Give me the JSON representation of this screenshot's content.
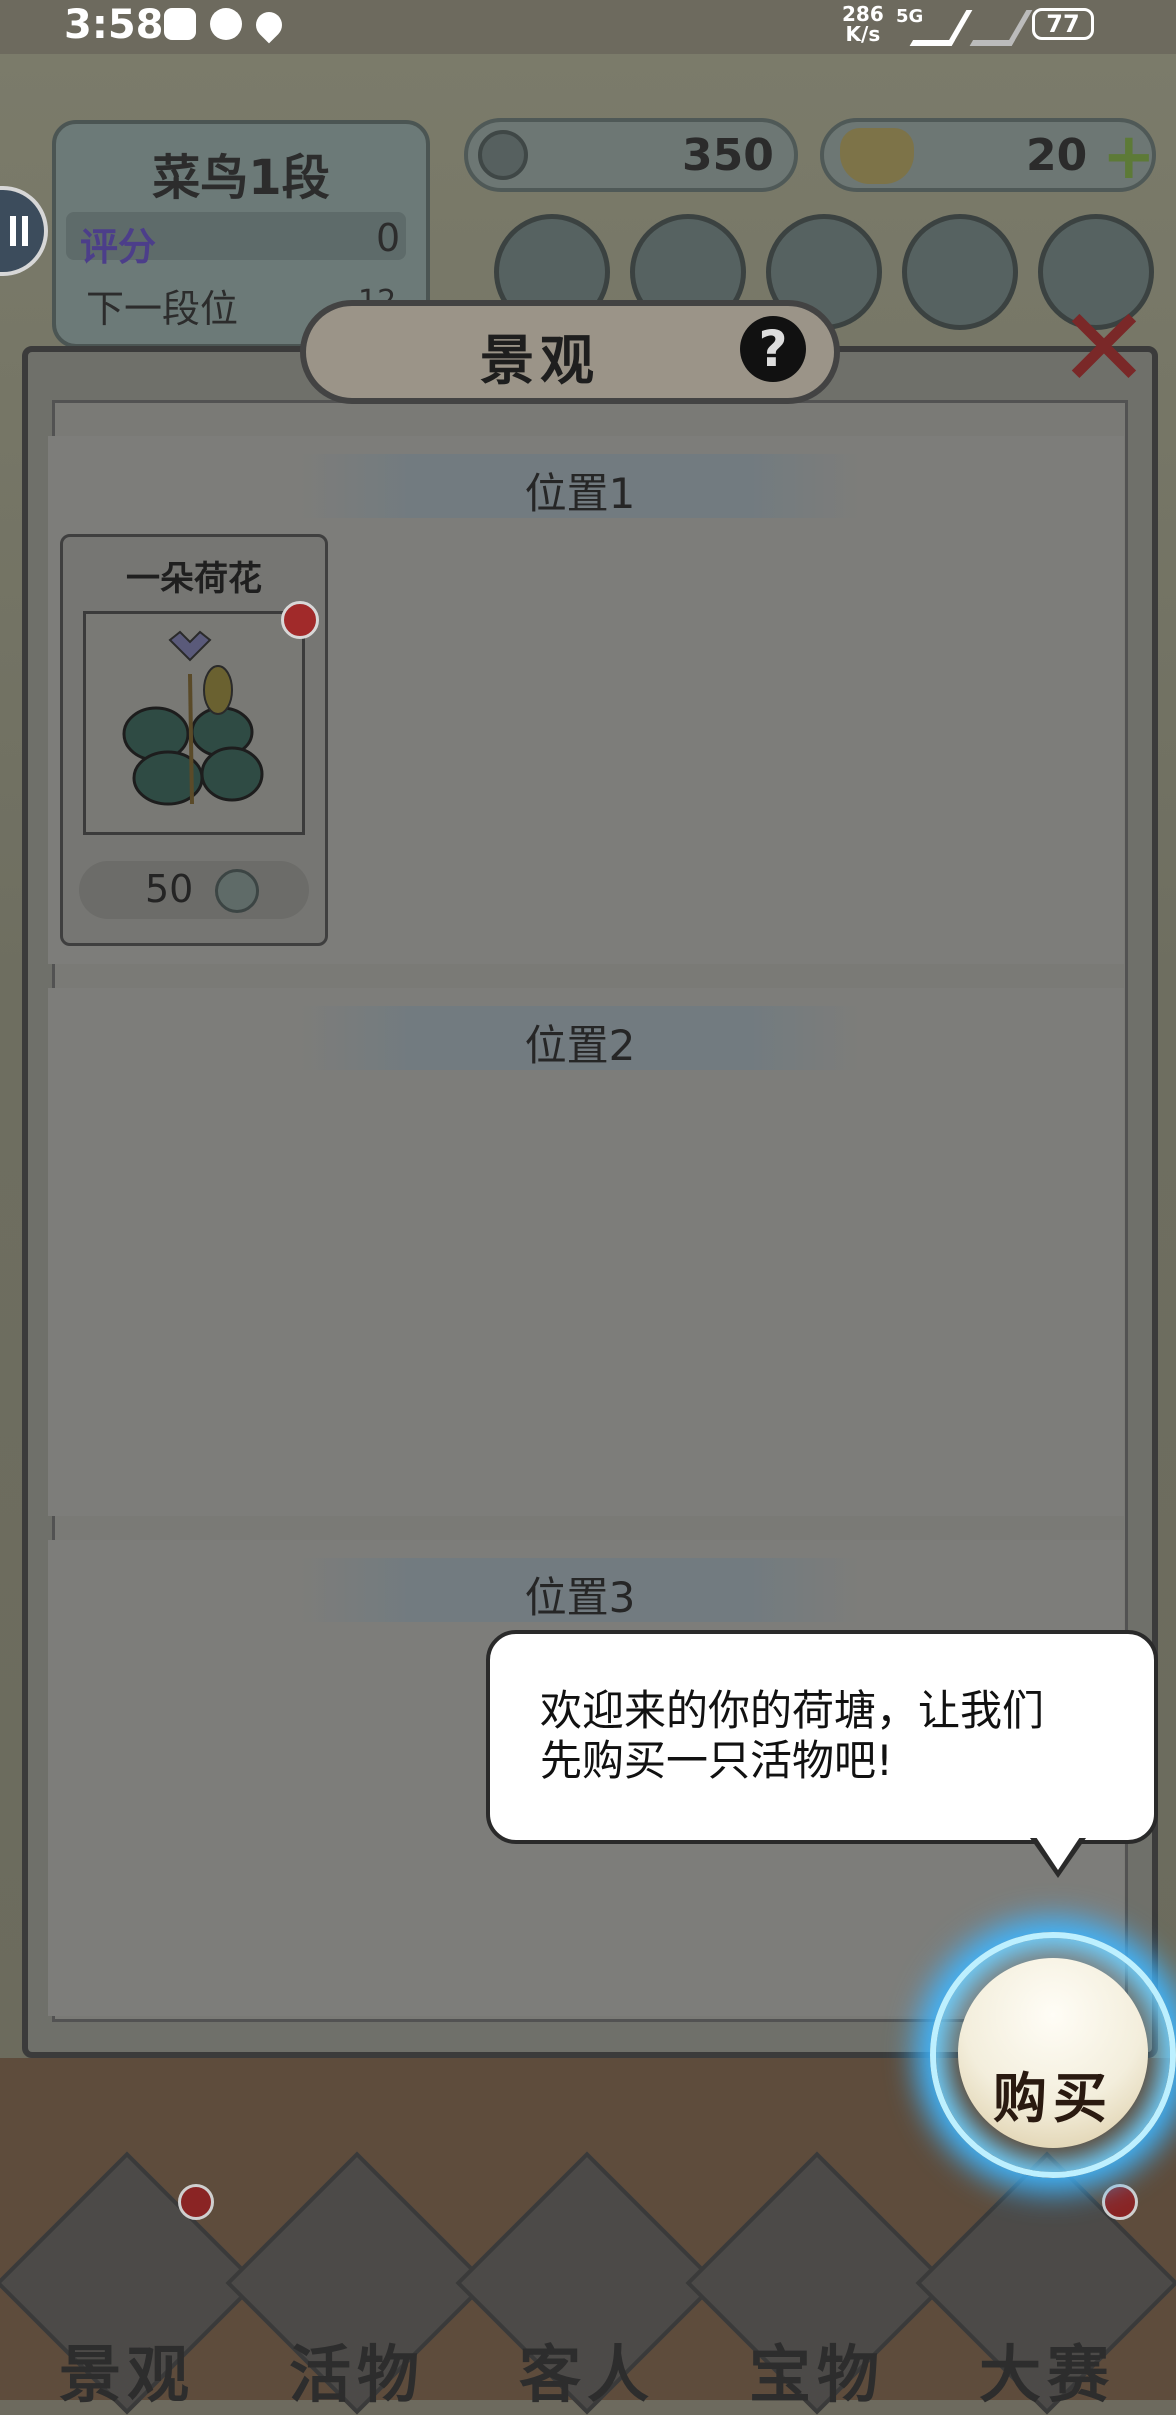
{
  "status_bar": {
    "time": "3:58",
    "net_speed_value": "286",
    "net_speed_unit": "K/s",
    "network": "5G",
    "battery": "77"
  },
  "rank_panel": {
    "title": "菜鸟1段",
    "score_label": "评分",
    "score_value": "0",
    "next_label": "下一段位",
    "next_value": "12"
  },
  "currency": {
    "coins": "350",
    "gold": "20",
    "add_symbol": "+"
  },
  "top_buttons": [
    "notes-icon",
    "whirlpool-icon",
    "scroll-icon",
    "card-icon",
    "gear-icon"
  ],
  "dialog": {
    "title": "景观",
    "help": "?",
    "close": "✕",
    "slots": [
      {
        "label": "位置1"
      },
      {
        "label": "位置2"
      },
      {
        "label": "位置3"
      }
    ],
    "item": {
      "name": "一朵荷花",
      "price": "50"
    }
  },
  "tutorial": {
    "line1": "欢迎来的你的荷塘，让我们",
    "line2": "先购买一只活物吧!"
  },
  "buy_button": {
    "label": "购买"
  },
  "bottom_nav": [
    {
      "label": "景观",
      "icon": "rock-icon"
    },
    {
      "label": "活物",
      "icon": "koi-fish-icon"
    },
    {
      "label": "客人",
      "icon": "guest-girl-icon"
    },
    {
      "label": "宝物",
      "icon": "pearl-shell-icon"
    },
    {
      "label": "大赛",
      "icon": "trophy-fish-icon"
    }
  ],
  "colors": {
    "accent_red": "#c8383b",
    "glow_blue": "#3fb6ff",
    "plus_green": "#7ab04a"
  }
}
